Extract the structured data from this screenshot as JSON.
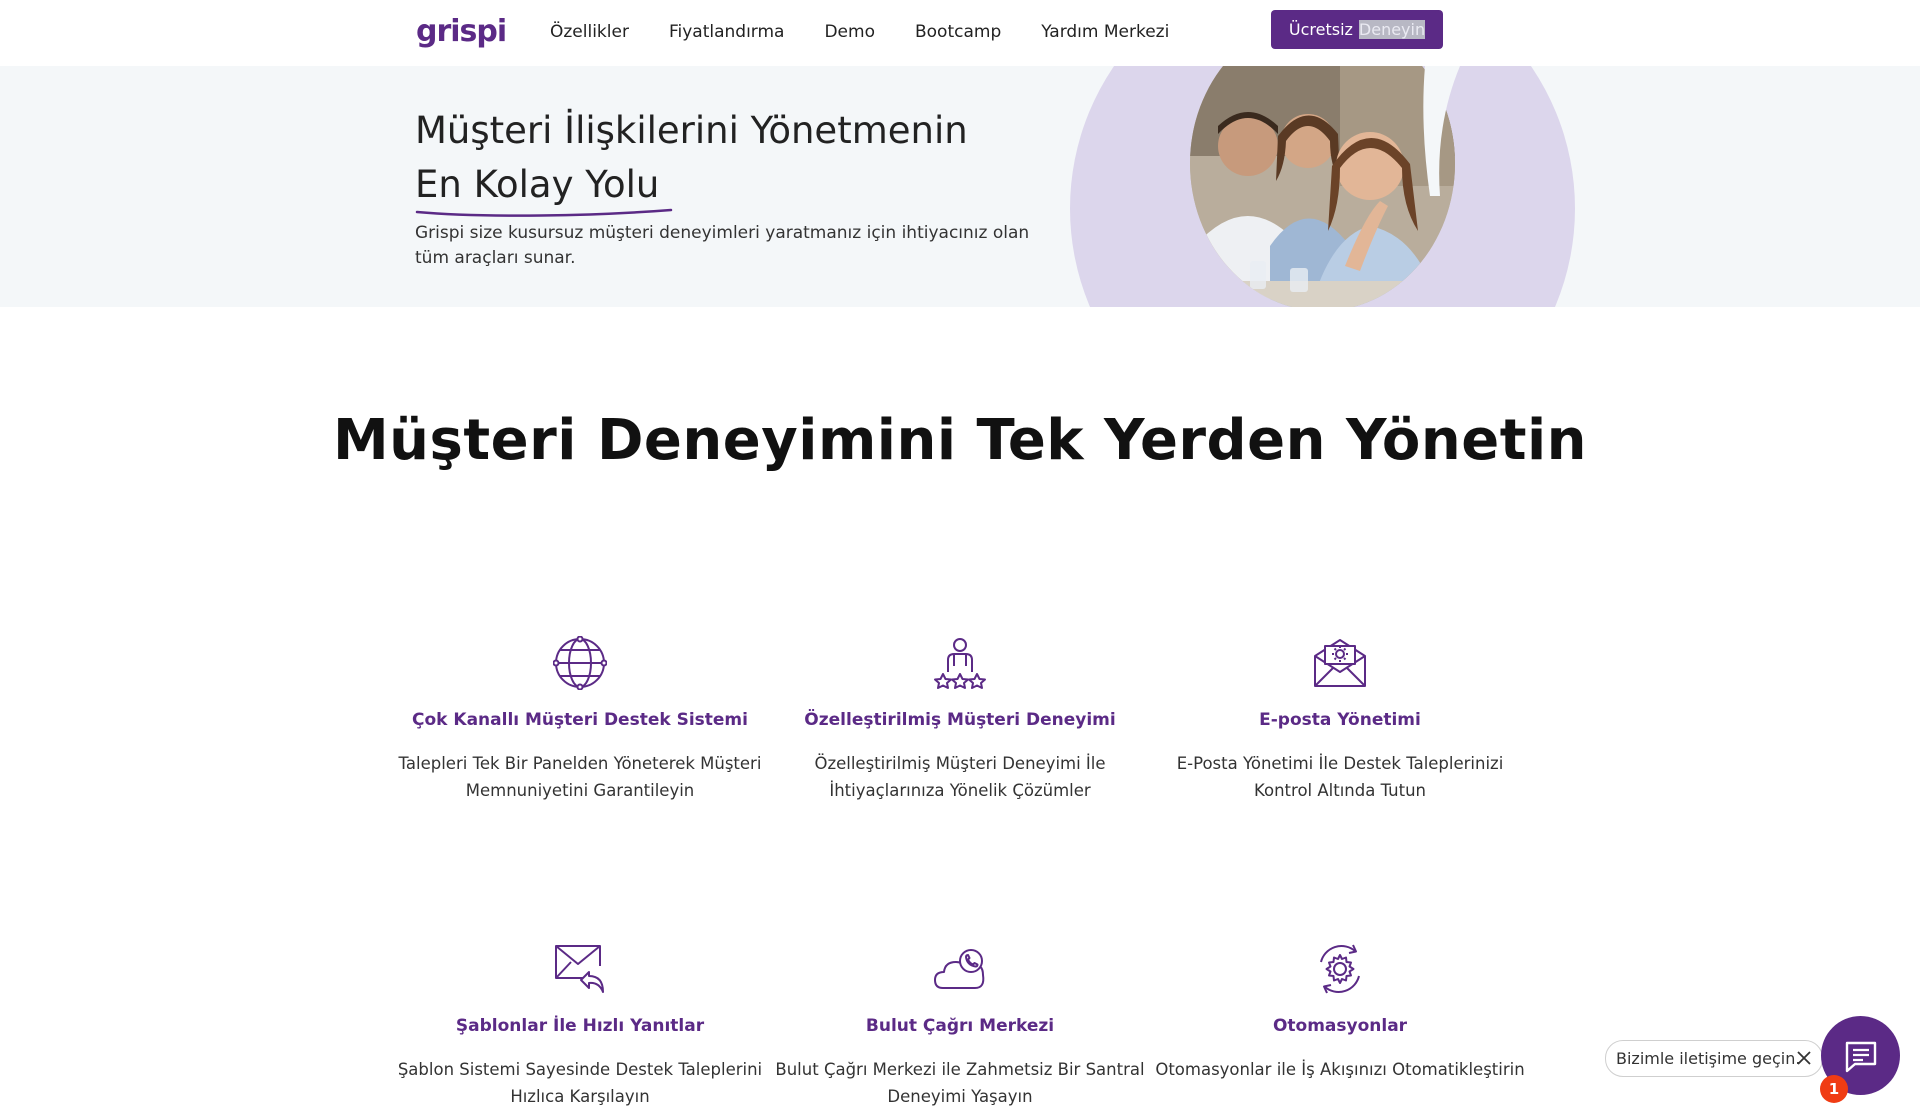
{
  "nav": {
    "logo": "grispi",
    "links": [
      "Özellikler",
      "Fiyatlandırma",
      "Demo",
      "Bootcamp",
      "Yardım Merkezi"
    ],
    "cta_first": "Ücretsiz",
    "cta_selected": "Deneyin"
  },
  "hero": {
    "title_line1": "Müşteri İlişkilerini Yönetmenin",
    "title_line2": "En Kolay Yolu",
    "subtitle": "Grispi size kusursuz müşteri deneyimleri yaratmanız için ihtiyacınız olan tüm araçları sunar."
  },
  "main": {
    "heading": "Müşteri Deneyimini Tek Yerden Yönetin",
    "features": [
      {
        "icon": "globe-icon",
        "title": "Çok Kanallı Müşteri Destek Sistemi",
        "desc": "Talepleri Tek Bir Panelden Yöneterek Müşteri Memnuniyetini Garantileyin"
      },
      {
        "icon": "person-stars-icon",
        "title": "Özelleştirilmiş Müşteri Deneyimi",
        "desc": "Özelleştirilmiş Müşteri Deneyimi İle İhtiyaçlarınıza Yönelik Çözümler"
      },
      {
        "icon": "envelope-gear-icon",
        "title": "E-posta Yönetimi",
        "desc": "E-Posta Yönetimi İle Destek Taleplerinizi Kontrol Altında Tutun"
      },
      {
        "icon": "envelope-reply-icon",
        "title": "Şablonlar İle Hızlı Yanıtlar",
        "desc": "Şablon Sistemi Sayesinde Destek Taleplerini Hızlıca Karşılayın"
      },
      {
        "icon": "cloud-phone-icon",
        "title": "Bulut Çağrı Merkezi",
        "desc": "Bulut Çağrı Merkezi ile Zahmetsiz Bir Santral Deneyimi Yaşayın"
      },
      {
        "icon": "gear-cycle-icon",
        "title": "Otomasyonlar",
        "desc": "Otomasyonlar ile İş Akışınızı Otomatikleştirin"
      }
    ]
  },
  "chat": {
    "prompt": "Bizimle iletişime geçin.",
    "badge": "1"
  },
  "colors": {
    "brand": "#5b2a86",
    "hero_bg": "#f4f7f9",
    "blob": "#dcd6ec",
    "badge": "#f03c14"
  }
}
